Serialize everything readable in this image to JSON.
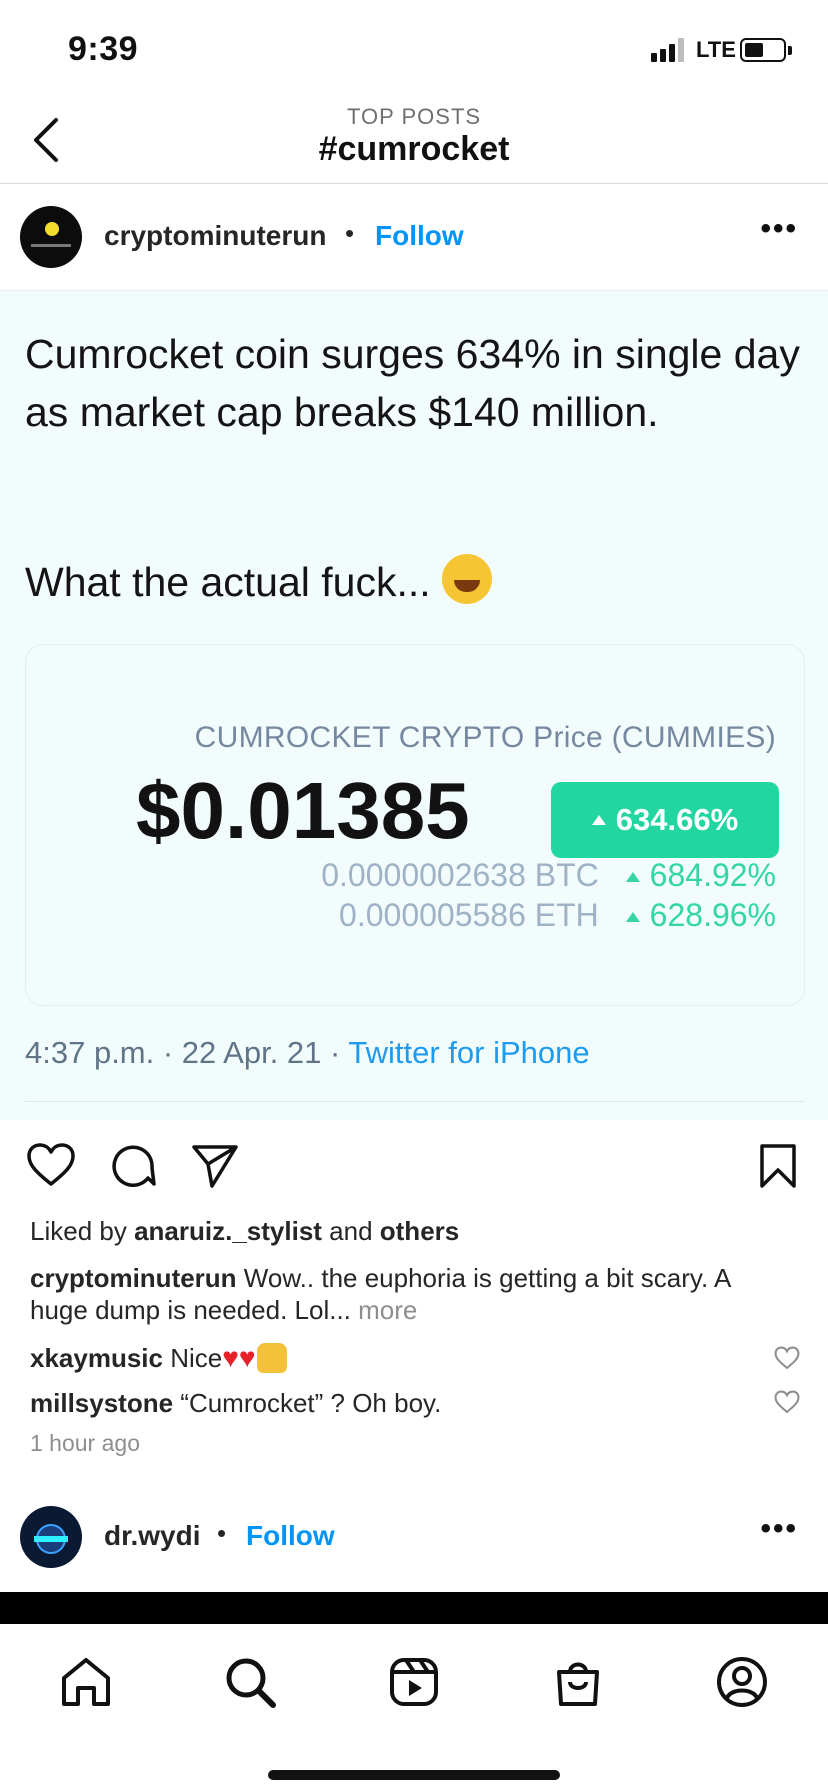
{
  "status_bar": {
    "time": "9:39",
    "network": "LTE"
  },
  "header": {
    "subtitle": "TOP POSTS",
    "title": "#cumrocket"
  },
  "post": {
    "username": "cryptominuterun",
    "separator": "•",
    "follow_label": "Follow",
    "more_label": "•••",
    "image": {
      "tweet_text": "Cumrocket coin surges 634% in single day as market cap breaks $140 million.",
      "tweet_text2": "What the actual fuck...",
      "card": {
        "title": "CUMROCKET CRYPTO Price (CUMMIES)",
        "price": "$0.01385",
        "change": "634.66%",
        "btc_value": "0.0000002638 BTC",
        "btc_change": "684.92%",
        "eth_value": "0.000005586 ETH",
        "eth_change": "628.96%"
      },
      "tweet_meta": "4:37 p.m. · 22 Apr. 21 · ",
      "tweet_source": "Twitter for iPhone"
    },
    "liked_prefix": "Liked by ",
    "liked_user": "anaruiz._stylist",
    "liked_mid": " and ",
    "liked_others": "others",
    "caption_user": "cryptominuterun",
    "caption_text": " Wow.. the euphoria is getting a bit scary. A huge dump is needed. Lol... ",
    "caption_more": "more",
    "comments": [
      {
        "user": "xkaymusic",
        "text": " Nice"
      },
      {
        "user": "millsystone",
        "text": " “Cumrocket” ? Oh boy."
      }
    ],
    "time_ago": "1 hour ago"
  },
  "next_post": {
    "username": "dr.wydi",
    "separator": "•",
    "follow_label": "Follow",
    "more_label": "•••"
  },
  "colors": {
    "link_blue": "#0095f6",
    "price_green": "#22d6a2",
    "image_bg": "#f2fcfc"
  }
}
